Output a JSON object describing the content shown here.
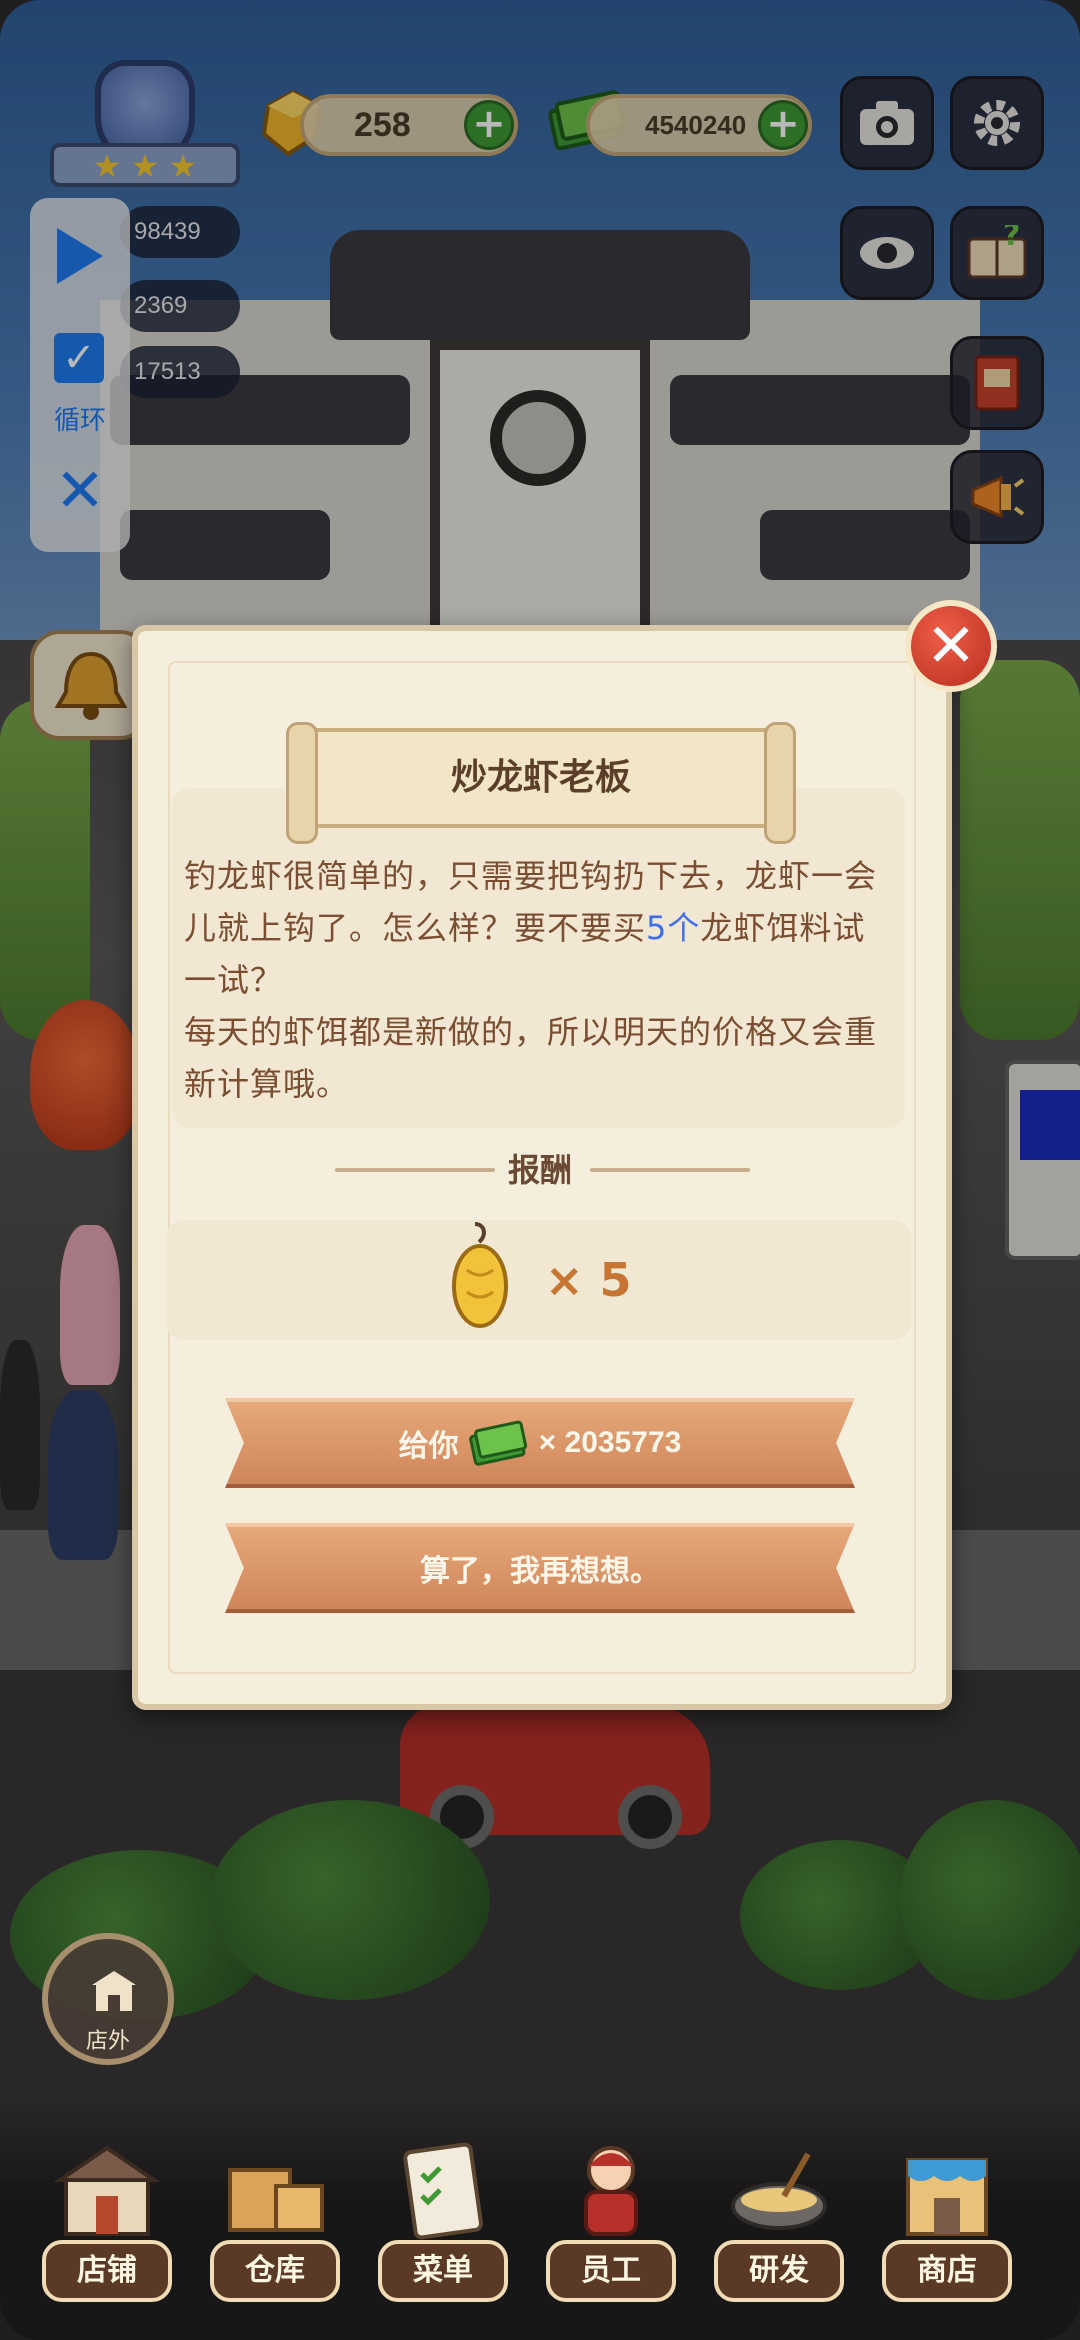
{
  "hud": {
    "gems": "258",
    "cash": "4540240",
    "stats": [
      "98439",
      "2369",
      "17513"
    ]
  },
  "float_panel": {
    "loop_label": "循环"
  },
  "dialog": {
    "title": "炒龙虾老板",
    "message_part1": "钓龙虾很简单的，只需要把钩扔下去，龙虾一会儿就上钩了。怎么样？要不要买",
    "message_highlight": "5个",
    "message_part2": "龙虾饵料试一试？",
    "message_part3": "每天的虾饵都是新做的，所以明天的价格又会重新计算哦。",
    "reward_title": "报酬",
    "reward_qty": "× 5",
    "accept_label": "给你",
    "accept_price": "× 2035773",
    "decline_label": "算了，我再想想。",
    "highlight_color": "#3d6ff0"
  },
  "outside_button": {
    "label": "店外"
  },
  "nav": [
    {
      "label": "店铺",
      "icon": "shop-building-icon"
    },
    {
      "label": "仓库",
      "icon": "warehouse-boxes-icon"
    },
    {
      "label": "菜单",
      "icon": "menu-clipboard-icon"
    },
    {
      "label": "员工",
      "icon": "staff-person-icon"
    },
    {
      "label": "研发",
      "icon": "cooking-pot-icon"
    },
    {
      "label": "商店",
      "icon": "store-front-icon"
    }
  ]
}
